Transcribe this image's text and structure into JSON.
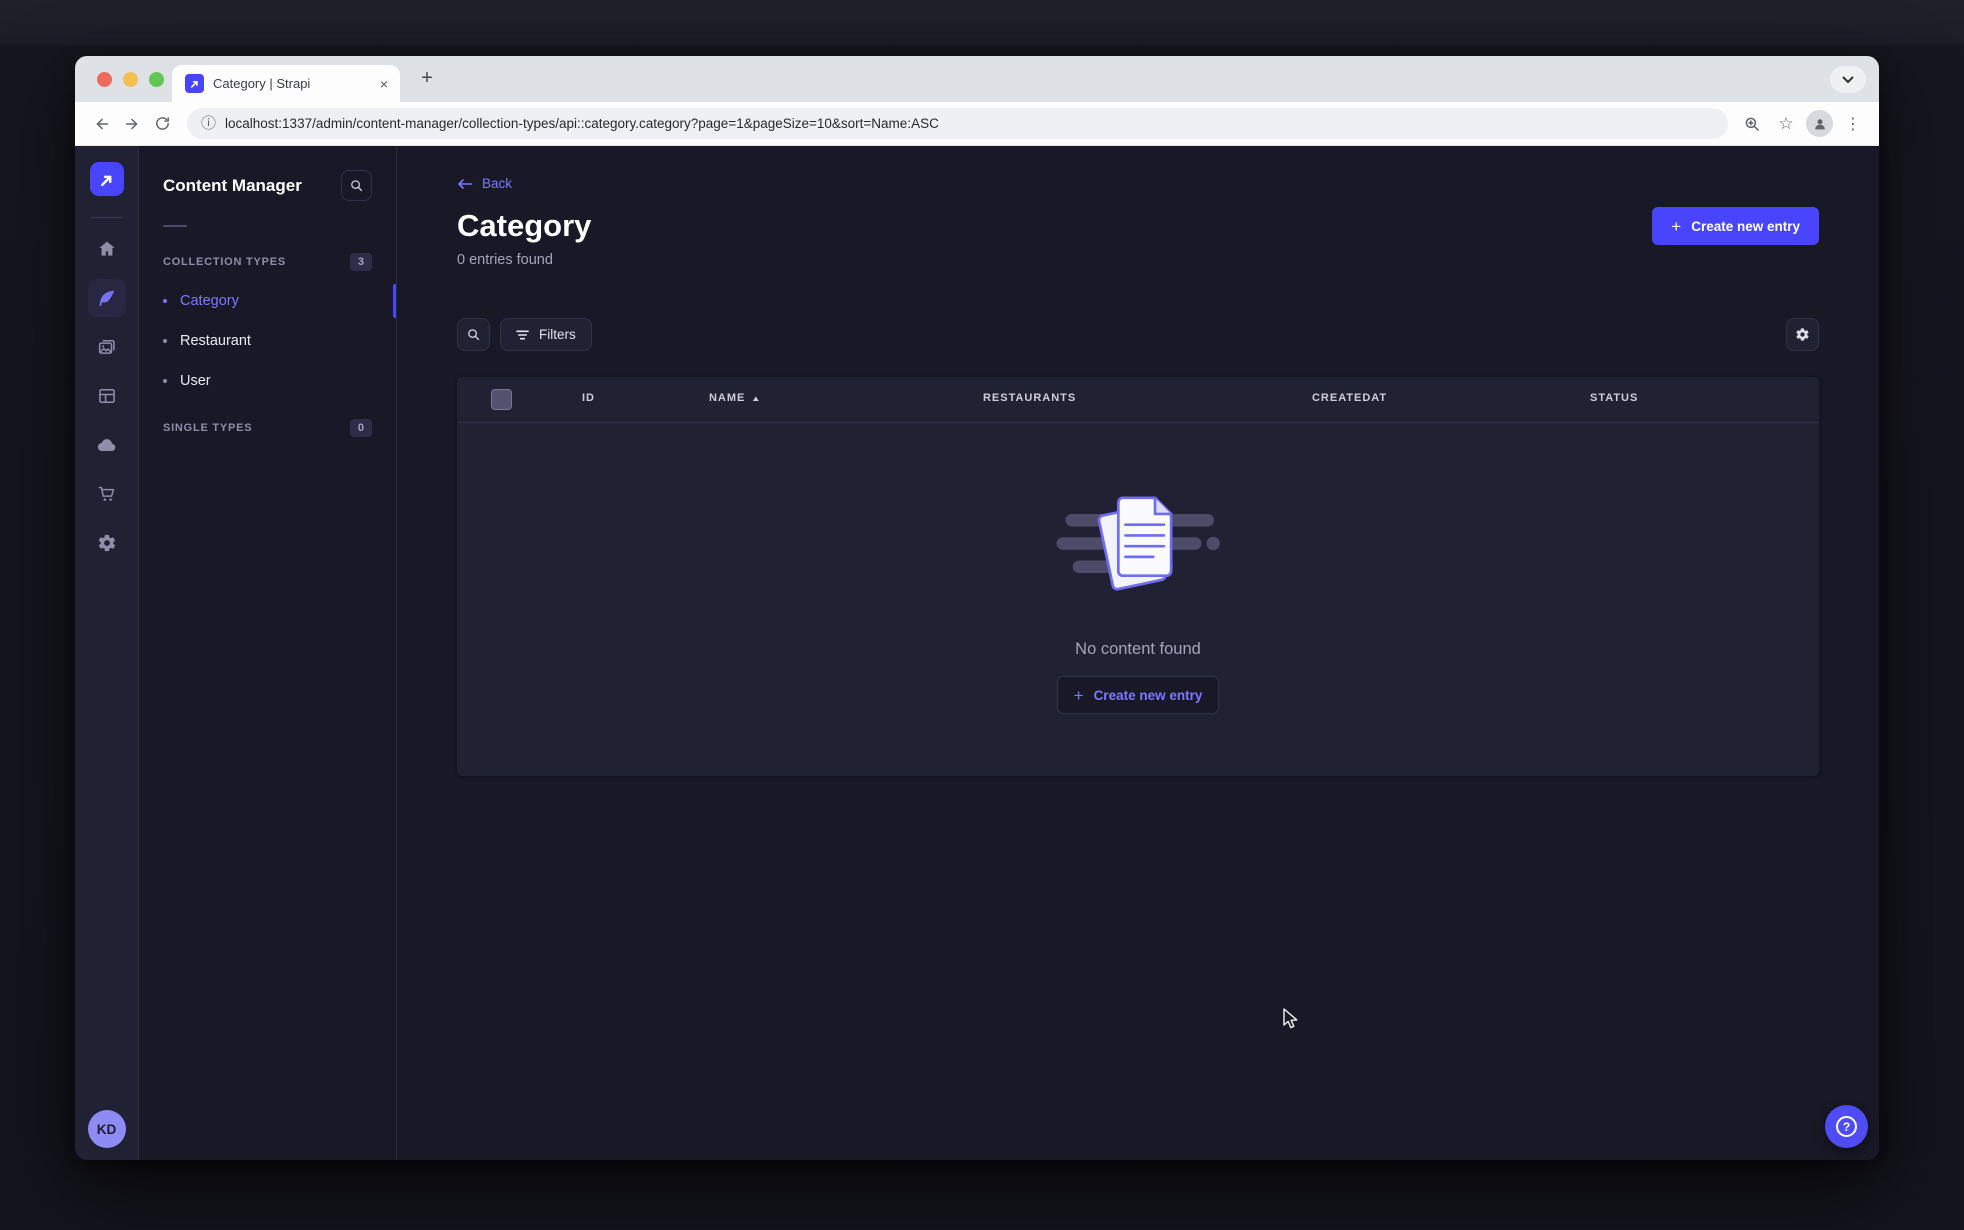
{
  "browser": {
    "tab_title": "Category | Strapi",
    "url": "localhost:1337/admin/content-manager/collection-types/api::category.category?page=1&pageSize=10&sort=Name:ASC"
  },
  "icons": {
    "close": "×",
    "plus": "+",
    "info": "ⓘ",
    "star": "☆",
    "overflow": "⋮",
    "sort_ascending": "▲",
    "question": "?"
  },
  "colors": {
    "primary": "#4945ff",
    "primary_light": "#7b79ff",
    "page_bg": "#181826",
    "card_bg": "#212134",
    "border": "#32324d",
    "sidebar_bg": "#212134",
    "avatar_bg": "#8e8cf4"
  },
  "sidebar": {
    "avatar_initials": "KD"
  },
  "subnav": {
    "title": "Content Manager",
    "collection_section": {
      "label": "COLLECTION TYPES",
      "badge": "3"
    },
    "items": [
      {
        "label": "Category",
        "active": true
      },
      {
        "label": "Restaurant",
        "active": false
      },
      {
        "label": "User",
        "active": false
      }
    ],
    "single_section": {
      "label": "SINGLE TYPES",
      "badge": "0"
    }
  },
  "main": {
    "back_label": "Back",
    "title": "Category",
    "subtitle": "0 entries found",
    "create_button_label": "Create new entry",
    "filters_label": "Filters",
    "table": {
      "columns": [
        "ID",
        "NAME",
        "RESTAURANTS",
        "CREATEDAT",
        "STATUS"
      ],
      "sorted_by": "NAME",
      "sort_direction": "ascending",
      "row_count": 0
    },
    "empty_state": {
      "message": "No content found",
      "cta_label": "Create new entry"
    }
  }
}
